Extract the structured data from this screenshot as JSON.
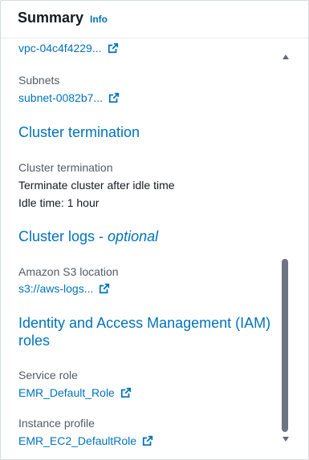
{
  "header": {
    "title": "Summary",
    "info": "Info"
  },
  "network": {
    "vpc_link": "vpc-04c4f4229...",
    "subnets_label": "Subnets",
    "subnets_link": "subnet-0082b7..."
  },
  "termination": {
    "heading": "Cluster termination",
    "label": "Cluster termination",
    "value": "Terminate cluster after idle time",
    "idle_time": "Idle time: 1 hour"
  },
  "logs": {
    "heading": "Cluster logs - ",
    "heading_optional": "optional",
    "s3_label": "Amazon S3 location",
    "s3_link": "s3://aws-logs..."
  },
  "iam": {
    "heading_line1": "Identity and Access Management (IAM)",
    "heading_line2": "roles",
    "service_role_label": "Service role",
    "service_role_link": "EMR_Default_Role",
    "instance_profile_label": "Instance profile",
    "instance_profile_link": "EMR_EC2_DefaultRole"
  },
  "colors": {
    "link": "#0073bb",
    "text": "#16191f",
    "label": "#545b64"
  },
  "icons": {
    "external": "external-link-icon"
  }
}
